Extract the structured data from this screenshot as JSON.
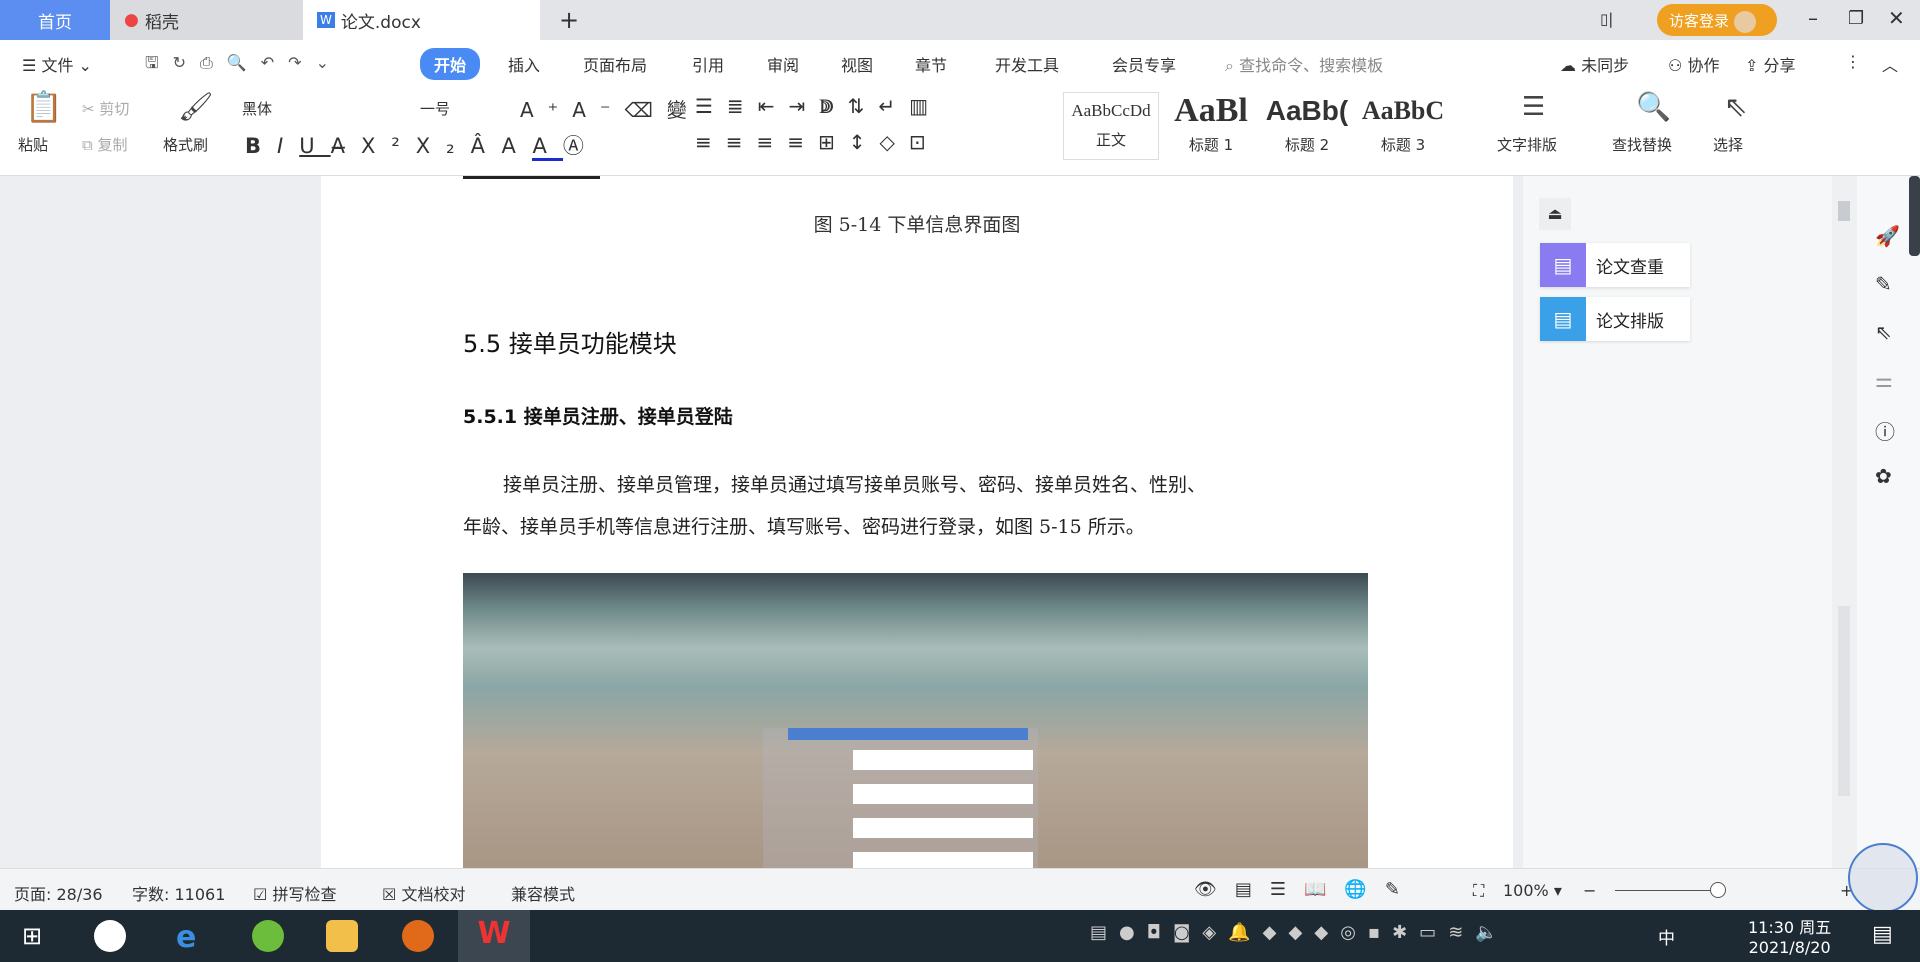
{
  "tabs": [
    {
      "label": "首页"
    },
    {
      "label": "稻壳"
    },
    {
      "label": "论文.docx"
    }
  ],
  "tabbar": {
    "login": "访客登录"
  },
  "menu": {
    "file": "文件",
    "tabs": [
      "开始",
      "插入",
      "页面布局",
      "引用",
      "审阅",
      "视图",
      "章节",
      "开发工具",
      "会员专享"
    ],
    "search_placeholder": "查找命令、搜索模板",
    "sync": "未同步",
    "collab": "协作",
    "share": "分享"
  },
  "ribbon": {
    "paste": "粘贴",
    "cut": "剪切",
    "copy": "复制",
    "format_painter": "格式刷",
    "font": "黑体",
    "size": "一号",
    "styles": [
      {
        "preview": "AaBbCcDd",
        "label": "正文"
      },
      {
        "preview": "AaBl",
        "label": "标题 1"
      },
      {
        "preview": "AaBb(",
        "label": "标题 2"
      },
      {
        "preview": "AaBbC",
        "label": "标题 3"
      }
    ],
    "text_layout": "文字排版",
    "find_replace": "查找替换",
    "select": "选择"
  },
  "document": {
    "caption": "图 5-14 下单信息界面图",
    "heading": "5.5  接单员功能模块",
    "subheading": "5.5.1 接单员注册、接单员登陆",
    "para1": "接单员注册、接单员管理，接单员通过填写接单员账号、密码、接单员姓名、性别、",
    "para2": "年龄、接单员手机等信息进行注册、填写账号、密码进行登录，如图 5-15 所示。"
  },
  "panel": {
    "check": "论文查重",
    "layout": "论文排版"
  },
  "status": {
    "page": "页面: 28/36",
    "words": "字数: 11061",
    "spell": "拼写检查",
    "proof": "文档校对",
    "compat": "兼容模式",
    "zoom": "100%",
    "zoom_level": 100
  },
  "taskbar": {
    "time": "11:30 周五",
    "date": "2021/8/20",
    "ime": "中"
  },
  "colors": {
    "accent": "#4a8af4",
    "home_tab": "#5b8ef0",
    "taskbar": "#1e2a33"
  }
}
